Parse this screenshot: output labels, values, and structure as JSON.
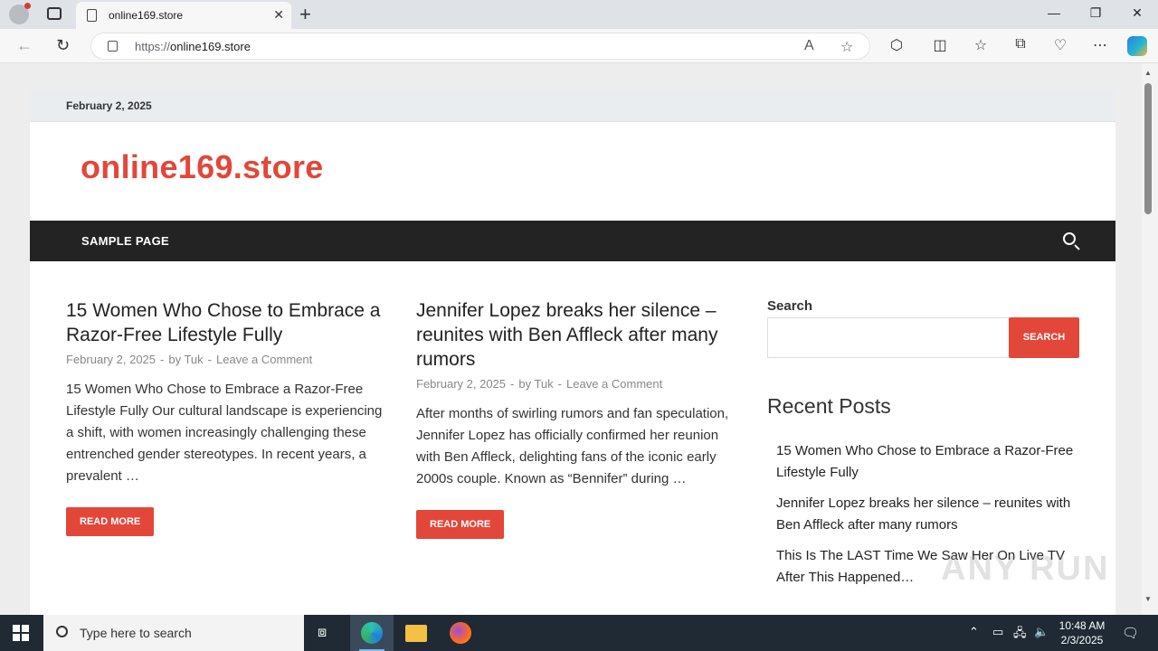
{
  "browser": {
    "tab_title": "online169.store",
    "url_scheme": "https://",
    "url_host": "online169.store"
  },
  "site": {
    "date": "February 2, 2025",
    "brand": "online169.store",
    "menu": [
      "SAMPLE PAGE"
    ],
    "posts": [
      {
        "title": "15 Women Who Chose to Embrace a Razor-Free Lifestyle Fully",
        "date": "February 2, 2025",
        "author": "by Tuk",
        "comment": "Leave a Comment",
        "excerpt": "15 Women Who Chose to Embrace a Razor-Free Lifestyle Fully Our cultural landscape is experiencing a shift, with women increasingly challenging these entrenched gender stereotypes. In recent years, a prevalent …",
        "read_more": "READ MORE"
      },
      {
        "title": "Jennifer Lopez breaks her silence – reunites with Ben Affleck after many rumors",
        "date": "February 2, 2025",
        "author": "by Tuk",
        "comment": "Leave a Comment",
        "excerpt": "After months of swirling rumors and fan speculation, Jennifer Lopez has officially confirmed her reunion with Ben Affleck, delighting fans of the iconic early 2000s couple. Known as “Bennifer” during …",
        "read_more": "READ MORE"
      }
    ],
    "sidebar": {
      "search_label": "Search",
      "search_button": "SEARCH",
      "search_value": "",
      "recent_title": "Recent Posts",
      "recent_posts": [
        "15 Women Who Chose to Embrace a Razor-Free Lifestyle Fully",
        "Jennifer Lopez breaks her silence – reunites with Ben Affleck after many rumors",
        "This Is The LAST Time We Saw Her On Live TV After This Happened…"
      ]
    }
  },
  "watermark": "ANY RUN",
  "taskbar": {
    "search_placeholder": "Type here to search",
    "time": "10:48 AM",
    "date": "2/3/2025"
  },
  "colors": {
    "accent": "#e2473a",
    "navbar": "#232323",
    "taskbar": "#1f2a35"
  }
}
